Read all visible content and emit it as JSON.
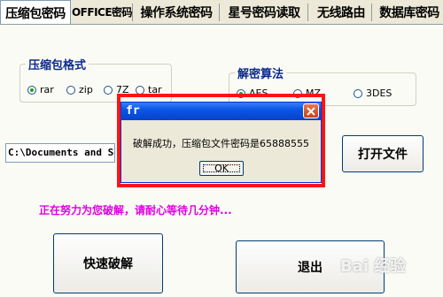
{
  "tabs": [
    {
      "label": "压缩包密码",
      "active": true
    },
    {
      "label": "OFFICE密码",
      "active": false
    },
    {
      "label": "操作系统密码",
      "active": false
    },
    {
      "label": "星号密码读取",
      "active": false
    },
    {
      "label": "无线路由",
      "active": false
    },
    {
      "label": "数据库密码",
      "active": false
    }
  ],
  "archive_format": {
    "title": "压缩包格式",
    "options": [
      "rar",
      "zip",
      "7Z",
      "tar"
    ],
    "selected": "rar"
  },
  "decrypt_algorithm": {
    "title": "解密算法",
    "options": [
      "AES",
      "MZ",
      "3DES"
    ],
    "selected": "AES"
  },
  "file_path": "C:\\Documents and Settings",
  "buttons": {
    "open_file": "打开文件",
    "quick_crack": "快速破解",
    "exit": "退出"
  },
  "status_text": "正在努力为您破解，请耐心等待几分钟...",
  "dialog": {
    "title": "fr",
    "message": "破解成功，压缩包文件密码是65888555",
    "ok": "OK"
  },
  "watermark": "Bai 经验",
  "colors": {
    "highlight_frame": "#ff1414",
    "status": "#e000e0",
    "title_bar": "#0a55e8"
  }
}
